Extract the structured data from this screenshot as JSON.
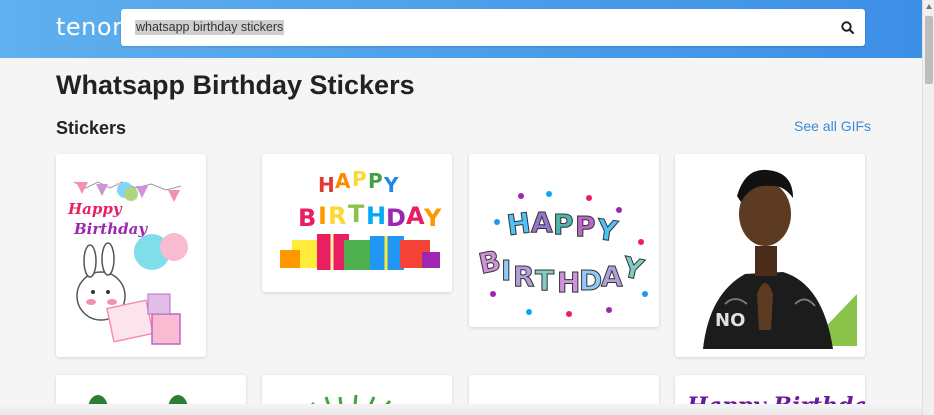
{
  "brand": {
    "logo": "tenor"
  },
  "search": {
    "query": "whatsapp birthday stickers"
  },
  "page": {
    "title": "Whatsapp Birthday Stickers"
  },
  "section": {
    "title": "Stickers",
    "see_all": "See all GIFs"
  },
  "stickers": [
    {
      "name": "bunny-happy-birthday-sticker",
      "text": "Happy Birthday"
    },
    {
      "name": "happy-birthday-gifts-sticker",
      "text": "HAPPY BIRTHDAY"
    },
    {
      "name": "happy-birthday-letters-sticker",
      "text": "HAPPY BIRTHDAY"
    },
    {
      "name": "man-praying-hands-sticker",
      "text": ""
    },
    {
      "name": "green-cactus-sticker",
      "text": ""
    },
    {
      "name": "green-burst-sticker",
      "text": ""
    },
    {
      "name": "partial-green-sticker",
      "text": ""
    },
    {
      "name": "purple-happy-birthday-sticker",
      "text": "Happy Birthday"
    }
  ],
  "colors": {
    "header_start": "#5fb0ee",
    "header_end": "#3c8fe6",
    "link": "#3a8bd6"
  }
}
